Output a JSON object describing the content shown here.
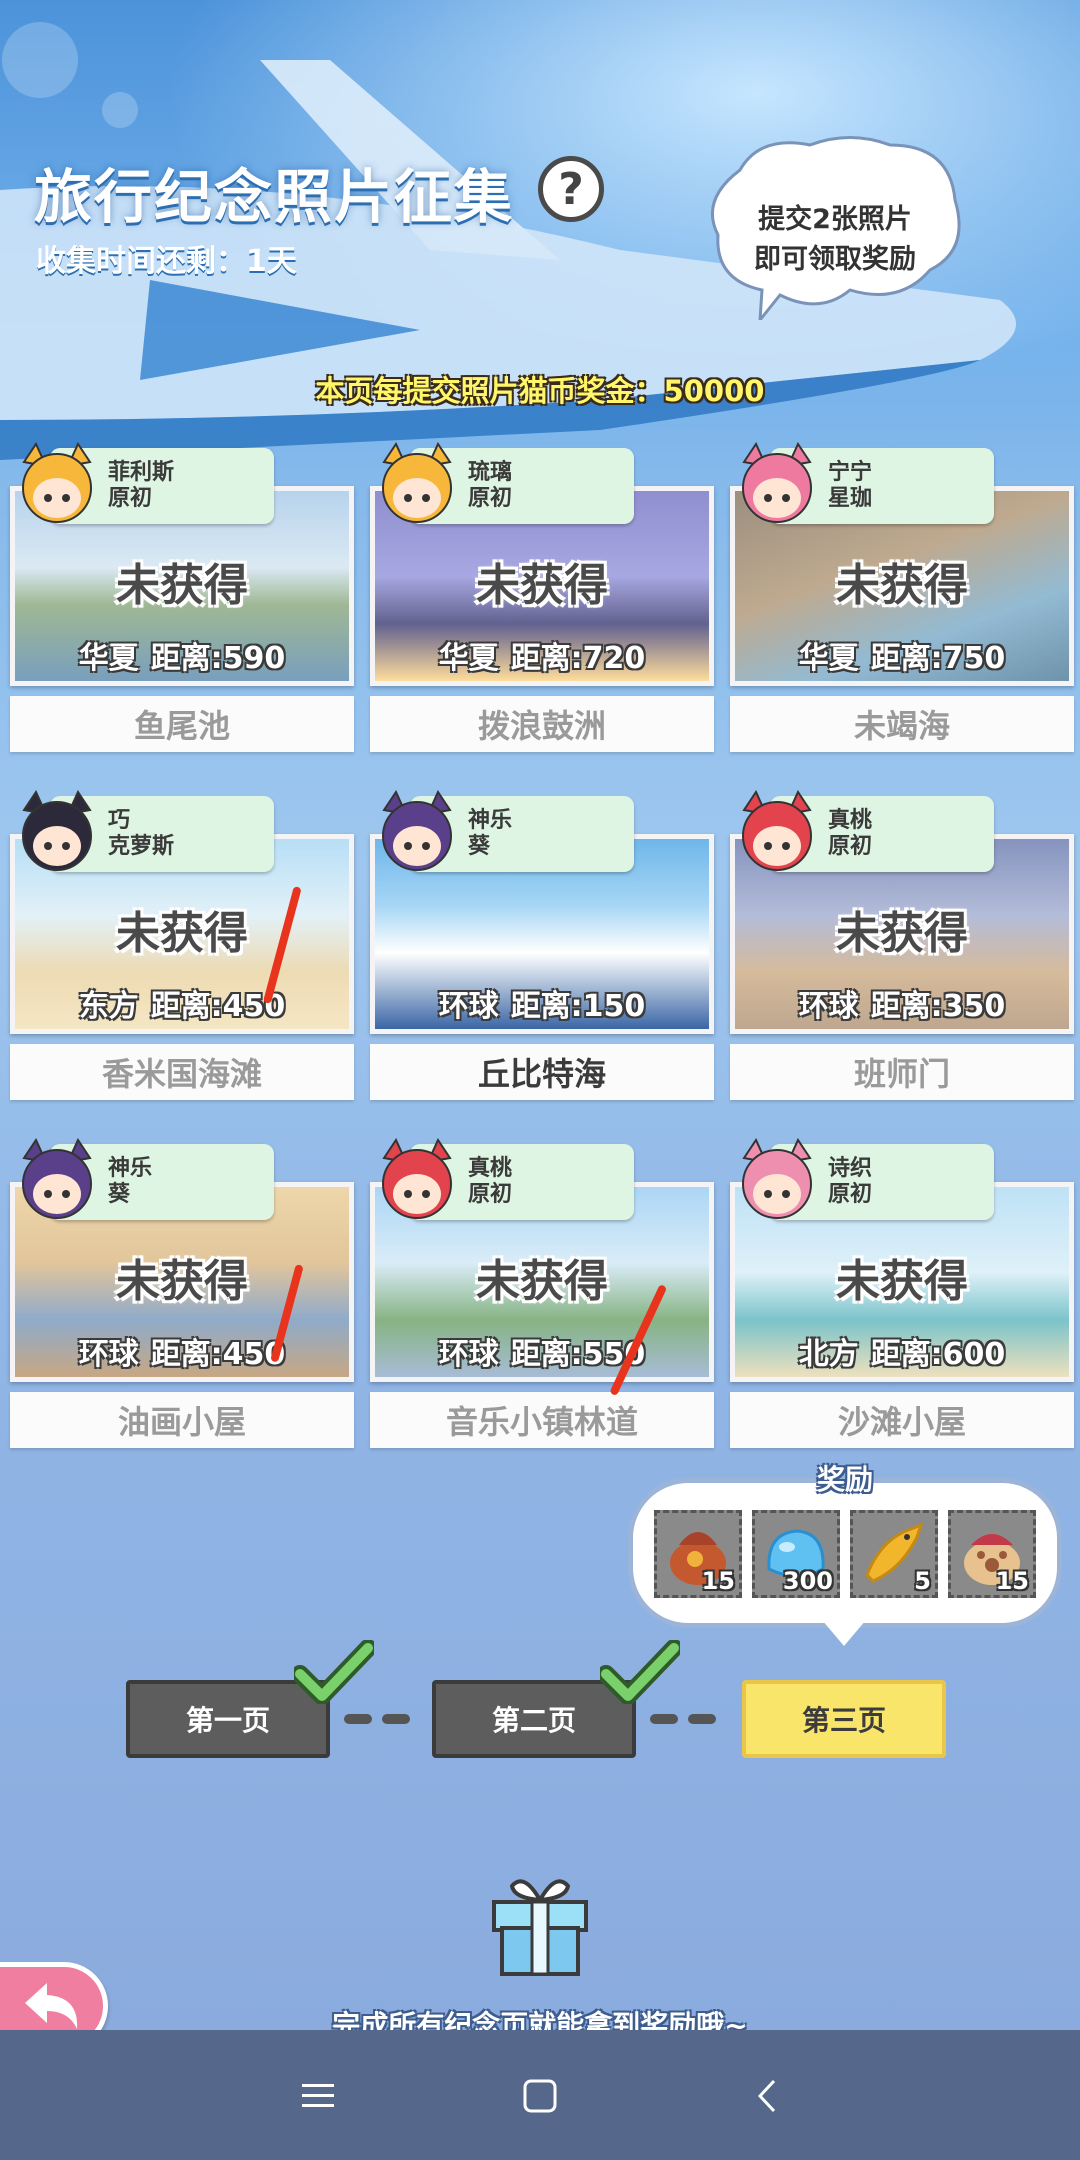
{
  "header": {
    "title": "旅行纪念照片征集",
    "help_symbol": "?",
    "timer": "收集时间还剩：1天",
    "bubble_lines": [
      "提交2张照片",
      "即可领取奖励"
    ],
    "bonus": "本页每提交照片猫币奖金：50000"
  },
  "cards": [
    {
      "char_line1": "菲利斯",
      "char_line2": "原初",
      "status": "未获得",
      "region": "华夏",
      "distance": "距离:590",
      "name": "鱼尾池",
      "obtained": false
    },
    {
      "char_line1": "琉璃",
      "char_line2": "原初",
      "status": "未获得",
      "region": "华夏",
      "distance": "距离:720",
      "name": "拨浪鼓洲",
      "obtained": false
    },
    {
      "char_line1": "宁宁",
      "char_line2": "星珈",
      "status": "未获得",
      "region": "华夏",
      "distance": "距离:750",
      "name": "未竭海",
      "obtained": false
    },
    {
      "char_line1": "巧",
      "char_line2": "克萝斯",
      "status": "未获得",
      "region": "东方",
      "distance": "距离:450",
      "name": "香米国海滩",
      "obtained": false
    },
    {
      "char_line1": "神乐",
      "char_line2": "葵",
      "status": "",
      "region": "环球",
      "distance": "距离:150",
      "name": "丘比特海",
      "obtained": true
    },
    {
      "char_line1": "真桃",
      "char_line2": "原初",
      "status": "未获得",
      "region": "环球",
      "distance": "距离:350",
      "name": "班师门",
      "obtained": false
    },
    {
      "char_line1": "神乐",
      "char_line2": "葵",
      "status": "未获得",
      "region": "环球",
      "distance": "距离:450",
      "name": "油画小屋",
      "obtained": false
    },
    {
      "char_line1": "真桃",
      "char_line2": "原初",
      "status": "未获得",
      "region": "环球",
      "distance": "距离:550",
      "name": "音乐小镇林道",
      "obtained": false
    },
    {
      "char_line1": "诗织",
      "char_line2": "原初",
      "status": "未获得",
      "region": "北方",
      "distance": "距离:600",
      "name": "沙滩小屋",
      "obtained": false
    }
  ],
  "reward": {
    "title": "奖励",
    "items": [
      {
        "icon": "treasure-bag-icon",
        "count": "15"
      },
      {
        "icon": "blue-slime-icon",
        "count": "300"
      },
      {
        "icon": "fish-icon",
        "count": "5"
      },
      {
        "icon": "paw-bag-icon",
        "count": "15"
      }
    ]
  },
  "pages": [
    {
      "label": "第一页",
      "completed": true
    },
    {
      "label": "第二页",
      "completed": true
    },
    {
      "label": "第三页",
      "completed": false
    }
  ],
  "footer": {
    "message": "完成所有纪念页就能拿到奖励哦~"
  },
  "colors": {
    "tag_bg": "#dff5e3",
    "active_page": "#f8e56a",
    "inactive_page": "#5d5d5d",
    "check_green": "#7ad06a",
    "navbar": "#55678b"
  }
}
